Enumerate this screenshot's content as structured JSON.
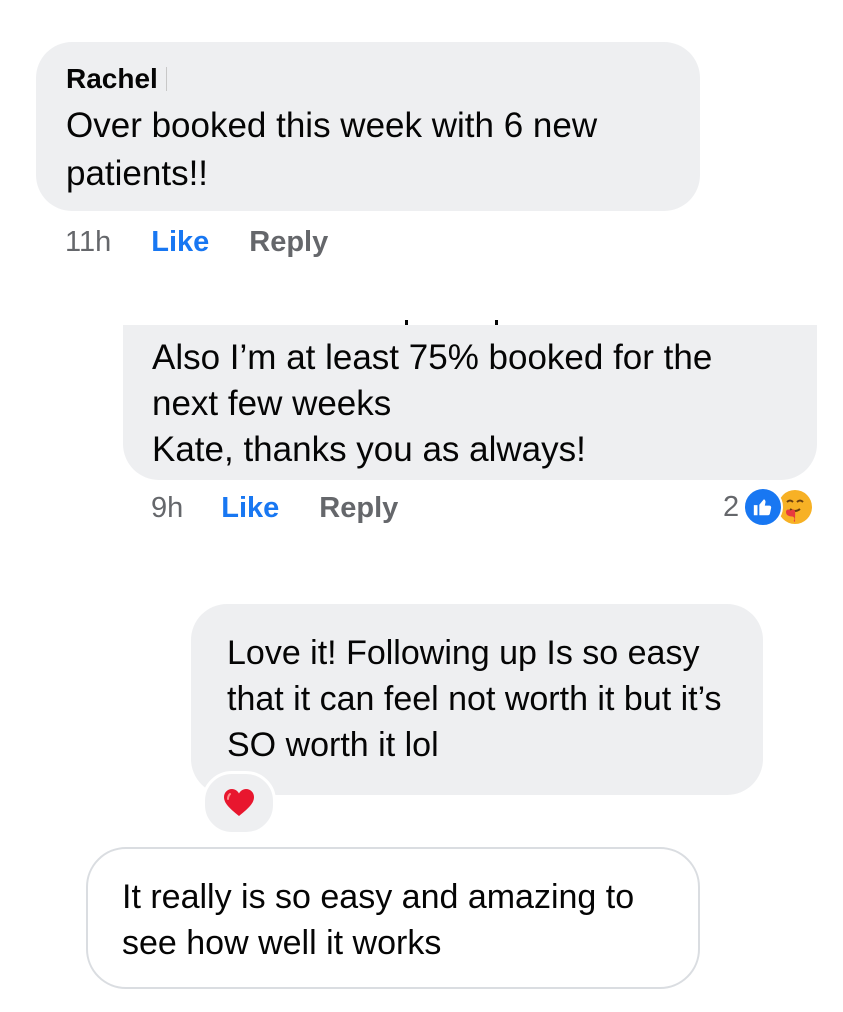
{
  "comments": [
    {
      "author": "Rachel",
      "text": "Over booked this week with 6 new patients!!",
      "time": "11h",
      "like_label": "Like",
      "reply_label": "Reply"
    },
    {
      "lines": [
        "Also I’m at least 75% booked for the",
        "next few weeks",
        "Kate, thanks you as always!"
      ],
      "time": "9h",
      "like_label": "Like",
      "reply_label": "Reply",
      "reaction_count": "2",
      "reaction_icons": [
        "like-icon",
        "care-icon"
      ]
    },
    {
      "text": "Love it! Following up Is so easy that it can feel not worth it but it’s SO worth it lol",
      "reaction_icon": "heart-icon"
    },
    {
      "text": "It really is so easy and amazing to see how well it works"
    }
  ],
  "colors": {
    "bubble": "#eeeff1",
    "like_blue": "#1877f2",
    "muted": "#65676b"
  }
}
